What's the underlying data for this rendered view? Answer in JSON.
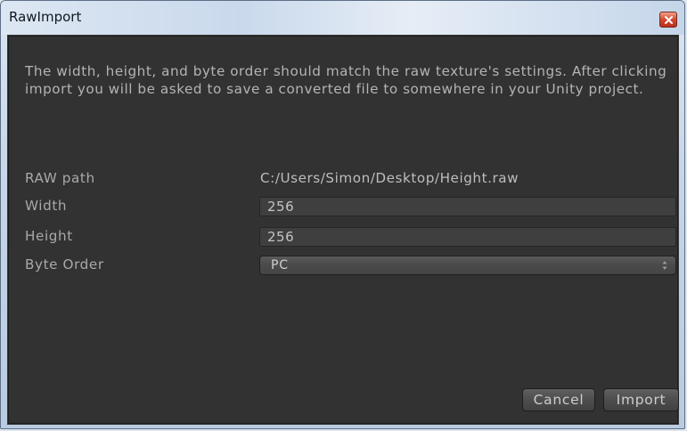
{
  "window": {
    "title": "RawImport"
  },
  "description": "The width, height, and byte order should match the raw texture's settings. After clicking import you will be asked to save a converted file to somewhere in your Unity project.",
  "fields": {
    "raw_path": {
      "label": "RAW path",
      "value": "C:/Users/Simon/Desktop/Height.raw"
    },
    "width": {
      "label": "Width",
      "value": "256"
    },
    "height": {
      "label": "Height",
      "value": "256"
    },
    "byte_order": {
      "label": "Byte Order",
      "value": "PC"
    }
  },
  "buttons": {
    "cancel": "Cancel",
    "import": "Import"
  },
  "icons": {
    "close": "close-icon",
    "dropdown": "dropdown-arrows-icon"
  },
  "colors": {
    "panel_background": "#323232",
    "text": "#b4b4b4",
    "close_button": "#d3492f"
  }
}
